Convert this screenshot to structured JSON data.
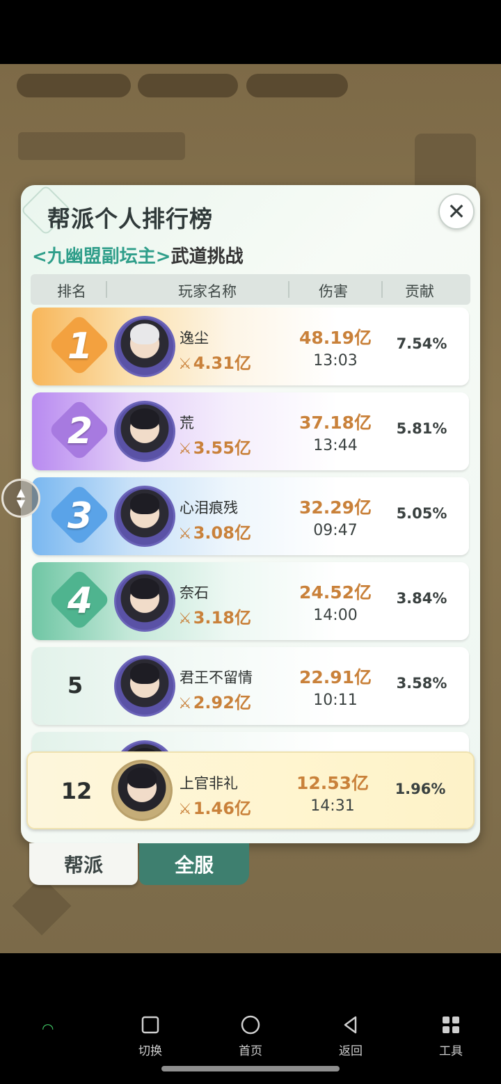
{
  "panel": {
    "title": "帮派个人排行榜",
    "close_icon": "close-icon",
    "subtitle_highlight": "<九幽盟副坛主>",
    "subtitle_rest": "武道挑战"
  },
  "table": {
    "headers": [
      "排名",
      "玩家名称",
      "伤害",
      "贡献"
    ],
    "rows": [
      {
        "rank": "1",
        "name": "逸尘",
        "power": "4.31亿",
        "damage": "48.19亿",
        "time": "13:03",
        "contribution": "7.54%"
      },
      {
        "rank": "2",
        "name": "荒",
        "power": "3.55亿",
        "damage": "37.18亿",
        "time": "13:44",
        "contribution": "5.81%"
      },
      {
        "rank": "3",
        "name": "心泪痕残",
        "power": "3.08亿",
        "damage": "32.29亿",
        "time": "09:47",
        "contribution": "5.05%"
      },
      {
        "rank": "4",
        "name": "奈石",
        "power": "3.18亿",
        "damage": "24.52亿",
        "time": "14:00",
        "contribution": "3.84%"
      },
      {
        "rank": "5",
        "name": "君王不留情",
        "power": "2.92亿",
        "damage": "22.91亿",
        "time": "10:11",
        "contribution": "3.58%"
      }
    ],
    "my_row": {
      "rank": "12",
      "name": "上官非礼",
      "power": "1.46亿",
      "damage": "12.53亿",
      "time": "14:31",
      "contribution": "1.96%"
    }
  },
  "tabs": {
    "guild": "帮派",
    "server": "全服"
  },
  "nav": {
    "switch": "切换",
    "home": "首页",
    "back": "返回",
    "tools": "工具"
  },
  "colors": {
    "rank1": "#f3a13f",
    "rank2": "#a77ae0",
    "rank3": "#5aa3e8",
    "rank4": "#4fb48f",
    "accent_orange": "#c9813a",
    "accent_green": "#2f9e8a"
  }
}
